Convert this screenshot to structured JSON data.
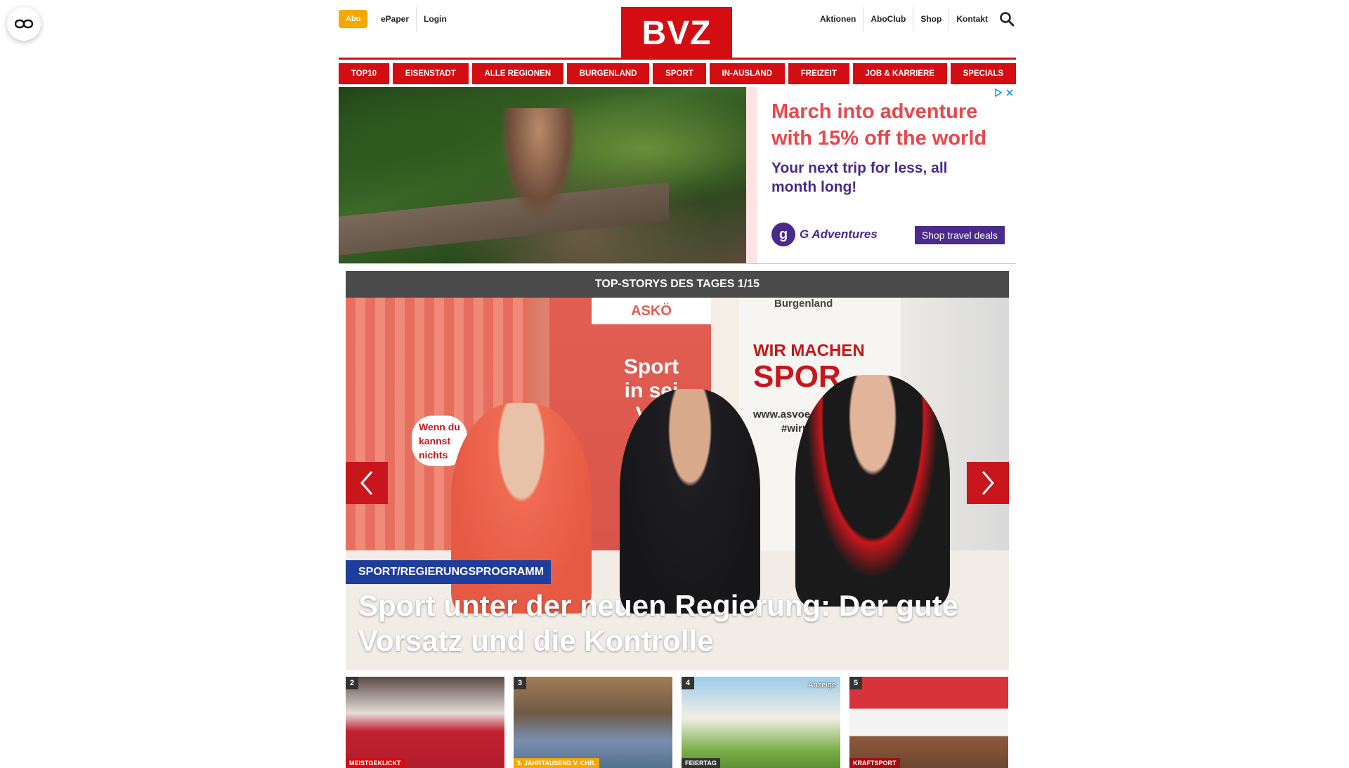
{
  "header": {
    "abo": "Abo",
    "left_links": [
      "ePaper",
      "Login"
    ],
    "logo": "BVZ",
    "right_links": [
      "Aktionen",
      "AboClub",
      "Shop",
      "Kontakt"
    ]
  },
  "nav": [
    "TOP10",
    "EISENSTADT",
    "ALLE REGIONEN",
    "BURGENLAND",
    "SPORT",
    "IN-AUSLAND",
    "FREIZEIT",
    "JOB & KARRIERE",
    "SPECIALS"
  ],
  "ad": {
    "headline": "March into adventure with 15% off the world",
    "subline": "Your next trip for less, all month long!",
    "brand": "G Adventures",
    "brand_mark": "g",
    "cta": "Shop travel deals"
  },
  "stories": {
    "header": "TOP-STORYS DES TAGES 1/15",
    "hero": {
      "category": "SPORT/REGIERUNGSPROGRAMM",
      "title": "Sport unter der neuen Regierung: Der gute Vorsatz und die Kontrolle",
      "banner_texts": {
        "asko": "ASKÖ",
        "sport_line1": "Sport",
        "sport_line2": "in sei",
        "sport_line3": "Vie",
        "wir_machen": "WIR MACHEN",
        "spo": "SPOR",
        "burgenland": "Burgenland",
        "wenn_du": "Wenn du",
        "kannst": "kannst",
        "nichts": "nichts",
        "url": "www.asvoe-burge",
        "hashtag": "#wirmach"
      }
    },
    "thumbs": [
      {
        "num": "2",
        "category": "MEISTGEKLICKT",
        "ad": ""
      },
      {
        "num": "3",
        "category": "5. JAHRTAUSEND V. CHR.",
        "ad": ""
      },
      {
        "num": "4",
        "category": "FEIERTAG",
        "ad": "Anzeige"
      },
      {
        "num": "5",
        "category": "KRAFTSPORT",
        "ad": ""
      }
    ]
  },
  "colors": {
    "brand_red": "#d40d12",
    "abo_orange": "#f5a800",
    "category_blue": "#1f3e9c",
    "ad_purple": "#4a2a8c"
  }
}
